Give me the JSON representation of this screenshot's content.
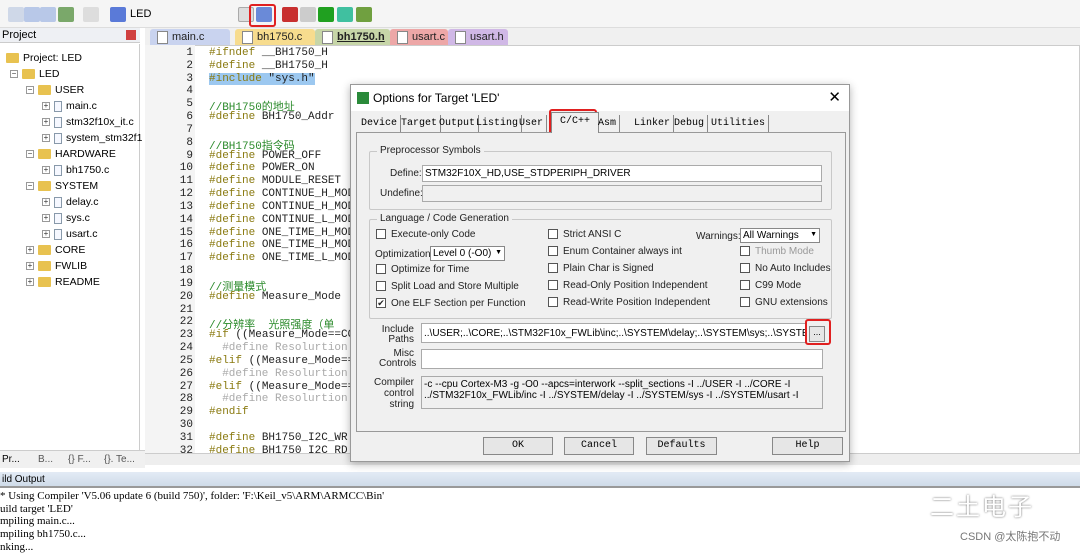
{
  "toolbar": {
    "target": "LED",
    "icons": [
      "save-icon",
      "download-icon",
      "build-icon",
      "batch-icon",
      "load-icon",
      "options-for-target-icon",
      "component-icon",
      "stack-icon",
      "diamond-icon",
      "pack-icon",
      "env-icon"
    ]
  },
  "file_tabs": [
    {
      "label": "main.c",
      "color": "#c9d3ef"
    },
    {
      "label": "bh1750.c",
      "color": "#f7dc8e"
    },
    {
      "label": "bh1750.h",
      "color": "#c7d6a8"
    },
    {
      "label": "usart.c",
      "color": "#eda7a7"
    },
    {
      "label": "usart.h",
      "color": "#d0b8e6"
    }
  ],
  "project": {
    "header": "Project",
    "tree": [
      {
        "label": "Project: LED",
        "level": 0
      },
      {
        "label": "LED",
        "level": 1
      },
      {
        "label": "USER",
        "level": 2
      },
      {
        "label": "main.c",
        "level": 3
      },
      {
        "label": "stm32f10x_it.c",
        "level": 3
      },
      {
        "label": "system_stm32f1",
        "level": 3
      },
      {
        "label": "HARDWARE",
        "level": 2
      },
      {
        "label": "bh1750.c",
        "level": 3
      },
      {
        "label": "SYSTEM",
        "level": 2
      },
      {
        "label": "delay.c",
        "level": 3
      },
      {
        "label": "sys.c",
        "level": 3
      },
      {
        "label": "usart.c",
        "level": 3
      },
      {
        "label": "CORE",
        "level": 2
      },
      {
        "label": "FWLIB",
        "level": 2
      },
      {
        "label": "README",
        "level": 2
      }
    ],
    "tabs": [
      "Pr...",
      "B...",
      "{} F...",
      "{}. Te..."
    ]
  },
  "code": [
    "#ifndef __BH1750_H",
    "#define __BH1750_H",
    "#include \"sys.h\"",
    "",
    "//BH1750的地址",
    "#define BH1750_Addr",
    "",
    "//BH1750指令码",
    "#define POWER_OFF",
    "#define POWER_ON",
    "#define MODULE_RESET",
    "#define CONTINUE_H_MODE",
    "#define CONTINUE_H_MODE",
    "#define CONTINUE_L_MODE",
    "#define ONE_TIME_H_MODE",
    "#define ONE_TIME_H_MODE",
    "#define ONE_TIME_L_MODE",
    "",
    "//测量模式",
    "#define Measure_Mode",
    "",
    "//分辨率  光照强度（单",
    "#if ((Measure_Mode==CO",
    "  #define Resolurtion",
    "#elif ((Measure_Mode==",
    "  #define Resolurtion",
    "#elif ((Measure_Mode==",
    "  #define Resolurtion",
    "#endif",
    "",
    "#define BH1750_I2C_WR",
    "#define BH1750_I2C_RD"
  ],
  "dialog": {
    "title": "Options for Target 'LED'",
    "tabs": [
      "Device",
      "Target",
      "Output",
      "Listing",
      "User",
      "C/C++",
      "Asm",
      "Linker",
      "Debug",
      "Utilities"
    ],
    "active_tab": "C/C++",
    "preprocessor": {
      "title": "Preprocessor Symbols",
      "define_label": "Define:",
      "define": "STM32F10X_HD,USE_STDPERIPH_DRIVER",
      "undefine_label": "Undefine:",
      "undefine": ""
    },
    "language": {
      "title": "Language / Code Generation",
      "optimization_label": "Optimization:",
      "optimization": "Level 0 (-O0)",
      "warnings_label": "Warnings:",
      "warnings": "All Warnings",
      "checks": [
        {
          "label": "Execute-only Code",
          "checked": false
        },
        {
          "label": "Optimize for Time",
          "checked": false
        },
        {
          "label": "Split Load and Store Multiple",
          "checked": false
        },
        {
          "label": "One ELF Section per Function",
          "checked": true
        },
        {
          "label": "Strict ANSI C",
          "checked": false
        },
        {
          "label": "Enum Container always int",
          "checked": false
        },
        {
          "label": "Plain Char is Signed",
          "checked": false
        },
        {
          "label": "Read-Only Position Independent",
          "checked": false
        },
        {
          "label": "Read-Write Position Independent",
          "checked": false
        },
        {
          "label": "Thumb Mode",
          "checked": false,
          "disabled": true
        },
        {
          "label": "No Auto Includes",
          "checked": false
        },
        {
          "label": "C99 Mode",
          "checked": false
        },
        {
          "label": "GNU extensions",
          "checked": false
        }
      ]
    },
    "include_label": "Include Paths",
    "include": "..\\USER;..\\CORE;..\\STM32F10x_FWLib\\inc;..\\SYSTEM\\delay;..\\SYSTEM\\sys;..\\SYSTEM\\usart;..\\",
    "browse": "...",
    "misc_label": "Misc Controls",
    "misc": "",
    "compiler_label": "Compiler control string",
    "compiler_line1": "-c --cpu Cortex-M3 -g -O0 --apcs=interwork --split_sections -I ../USER -I ../CORE -I",
    "compiler_line2": "../STM32F10x_FWLib/inc -I ../SYSTEM/delay -I ../SYSTEM/sys -I ../SYSTEM/usart -I",
    "buttons": {
      "ok": "OK",
      "cancel": "Cancel",
      "defaults": "Defaults",
      "help": "Help"
    }
  },
  "output": {
    "header": "ild Output",
    "lines": [
      "* Using Compiler 'V5.06 update 6 (build 750)', folder: 'F:\\Keil_v5\\ARM\\ARMCC\\Bin'",
      "uild target 'LED'",
      "mpiling main.c...",
      "mpiling bh1750.c...",
      "nking..."
    ]
  },
  "watermark": {
    "brand": "二土电子",
    "credit": "CSDN @太陈抱不动"
  },
  "highlight_color": "#e02020"
}
